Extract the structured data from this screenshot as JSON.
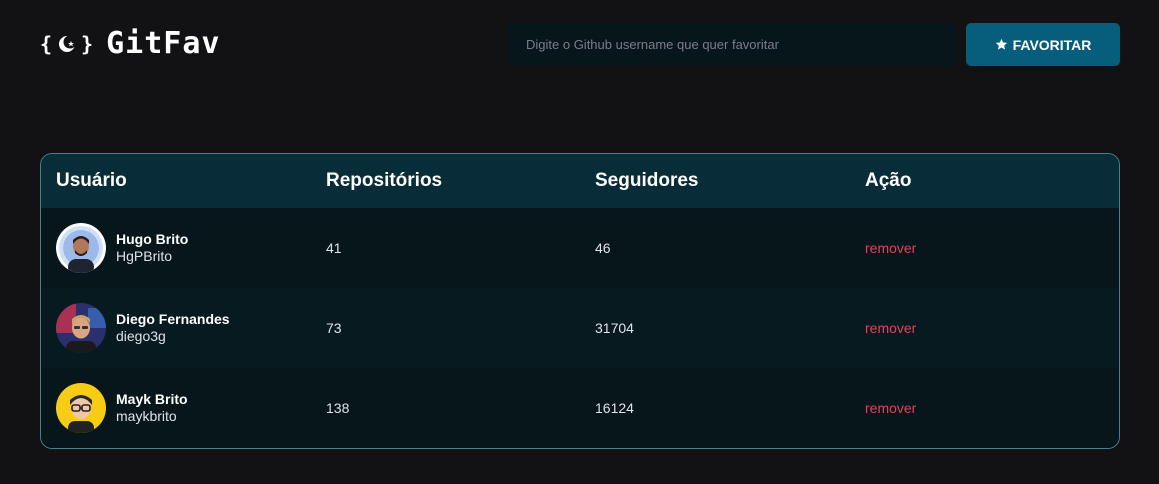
{
  "header": {
    "logo_open": "{",
    "logo_close": "}",
    "logo_icon": "moon-star-icon",
    "app_name": "GitFav",
    "search_placeholder": "Digite o Github username que quer favoritar",
    "search_value": "",
    "favorite_label": "FAVORITAR",
    "favorite_icon": "star-icon"
  },
  "table": {
    "columns": [
      "Usuário",
      "Repositórios",
      "Seguidores",
      "Ação"
    ],
    "rows": [
      {
        "name": "Hugo Brito",
        "login": "HgPBrito",
        "repos": "41",
        "followers": "46",
        "action": "remover"
      },
      {
        "name": "Diego Fernandes",
        "login": "diego3g",
        "repos": "73",
        "followers": "31704",
        "action": "remover"
      },
      {
        "name": "Mayk Brito",
        "login": "maykbrito",
        "repos": "138",
        "followers": "16124",
        "action": "remover"
      }
    ]
  },
  "colors": {
    "background": "#121214",
    "accent": "#065e7c",
    "table_header": "#092d38",
    "remove": "#e83f5b"
  }
}
